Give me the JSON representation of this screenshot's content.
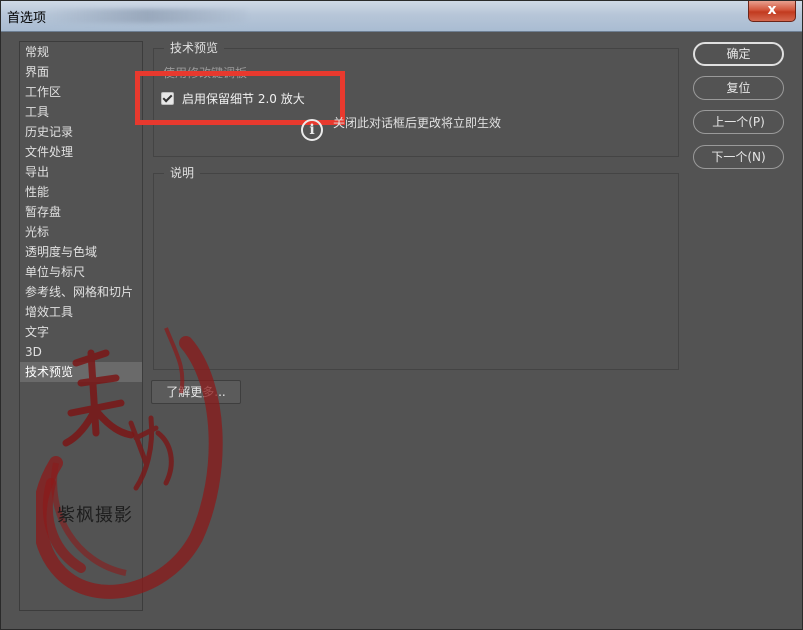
{
  "window": {
    "title": "首选项",
    "close_symbol": "x"
  },
  "nav": {
    "items": [
      {
        "label": "常规"
      },
      {
        "label": "界面"
      },
      {
        "label": "工作区"
      },
      {
        "label": "工具"
      },
      {
        "label": "历史记录"
      },
      {
        "label": "文件处理"
      },
      {
        "label": "导出"
      },
      {
        "label": "性能"
      },
      {
        "label": "暂存盘"
      },
      {
        "label": "光标"
      },
      {
        "label": "透明度与色域"
      },
      {
        "label": "单位与标尺"
      },
      {
        "label": "参考线、网格和切片"
      },
      {
        "label": "增效工具"
      },
      {
        "label": "文字"
      },
      {
        "label": "3D"
      },
      {
        "label": "技术预览"
      }
    ],
    "selected_index": 16
  },
  "tech_preview": {
    "group_title": "技术预览",
    "faded_option": "使用修改键调板",
    "checkbox_label": "启用保留细节 2.0 放大",
    "checkbox_checked": true,
    "info_text": "关闭此对话框后更改将立即生效",
    "info_icon": "info-icon"
  },
  "description": {
    "group_title": "说明"
  },
  "learn_more_label": "了解更多...",
  "buttons": {
    "ok": "确定",
    "reset": "复位",
    "prev": "上一个(P)",
    "next": "下一个(N)"
  },
  "watermark": {
    "text": "紫枫摄影"
  },
  "colors": {
    "panel_bg": "#535353",
    "highlight_border": "#e8392e",
    "watermark_red": "#8b1a1a"
  }
}
